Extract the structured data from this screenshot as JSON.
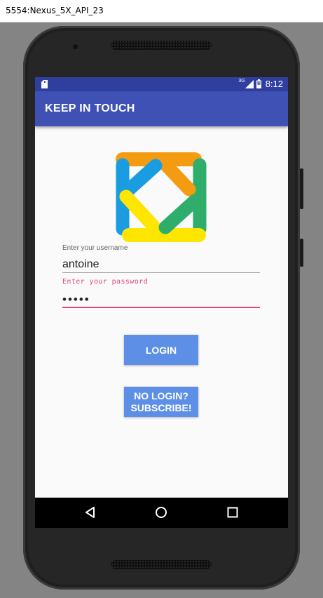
{
  "window": {
    "title": "5554:Nexus_5X_API_23"
  },
  "status_bar": {
    "network": "3G",
    "time": "8:12"
  },
  "toolbar": {
    "title": "KEEP IN TOUCH"
  },
  "login_form": {
    "username_label": "Enter your username",
    "username_value": "antoine",
    "password_label": "Enter your password",
    "password_value": "•••••"
  },
  "buttons": {
    "login": "LOGIN",
    "subscribe_line1": "NO LOGIN?",
    "subscribe_line2": "SUBSCRIBE!"
  },
  "colors": {
    "status_bar": "#303f9f",
    "toolbar": "#3f51b5",
    "button": "#5d8fe6",
    "accent": "#e0457b",
    "logo_orange": "#f39c12",
    "logo_blue": "#1a9de0",
    "logo_green": "#2fae6b",
    "logo_yellow": "#ffe600"
  },
  "icons": {
    "sd_card": "sd-card-icon",
    "signal": "signal-icon",
    "battery": "battery-icon",
    "back": "back-icon",
    "home": "home-icon",
    "recents": "recents-icon"
  }
}
